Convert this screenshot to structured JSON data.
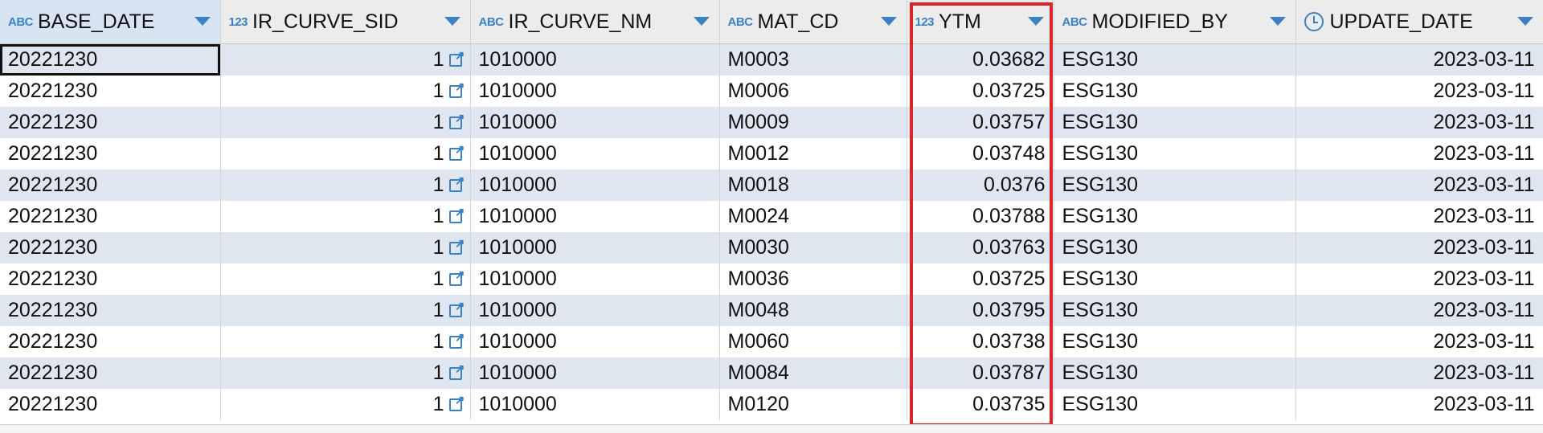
{
  "columns": [
    {
      "type": "ABC",
      "name": "BASE_DATE"
    },
    {
      "type": "123",
      "name": "IR_CURVE_SID"
    },
    {
      "type": "ABC",
      "name": "IR_CURVE_NM"
    },
    {
      "type": "ABC",
      "name": "MAT_CD"
    },
    {
      "type": "123",
      "name": "YTM"
    },
    {
      "type": "ABC",
      "name": "MODIFIED_BY"
    },
    {
      "type": "clock-icon",
      "name": "UPDATE_DATE"
    }
  ],
  "rows": [
    [
      "20221230",
      "1",
      "1010000",
      "M0003",
      "0.03682",
      "ESG130",
      "2023-03-11"
    ],
    [
      "20221230",
      "1",
      "1010000",
      "M0006",
      "0.03725",
      "ESG130",
      "2023-03-11"
    ],
    [
      "20221230",
      "1",
      "1010000",
      "M0009",
      "0.03757",
      "ESG130",
      "2023-03-11"
    ],
    [
      "20221230",
      "1",
      "1010000",
      "M0012",
      "0.03748",
      "ESG130",
      "2023-03-11"
    ],
    [
      "20221230",
      "1",
      "1010000",
      "M0018",
      "0.0376",
      "ESG130",
      "2023-03-11"
    ],
    [
      "20221230",
      "1",
      "1010000",
      "M0024",
      "0.03788",
      "ESG130",
      "2023-03-11"
    ],
    [
      "20221230",
      "1",
      "1010000",
      "M0030",
      "0.03763",
      "ESG130",
      "2023-03-11"
    ],
    [
      "20221230",
      "1",
      "1010000",
      "M0036",
      "0.03725",
      "ESG130",
      "2023-03-11"
    ],
    [
      "20221230",
      "1",
      "1010000",
      "M0048",
      "0.03795",
      "ESG130",
      "2023-03-11"
    ],
    [
      "20221230",
      "1",
      "1010000",
      "M0060",
      "0.03738",
      "ESG130",
      "2023-03-11"
    ],
    [
      "20221230",
      "1",
      "1010000",
      "M0084",
      "0.03787",
      "ESG130",
      "2023-03-11"
    ],
    [
      "20221230",
      "1",
      "1010000",
      "M0120",
      "0.03735",
      "ESG130",
      "2023-03-11"
    ]
  ],
  "colors": {
    "accent": "#3b82c4",
    "highlight": "#d8262c",
    "row_alt": "#dfe6f0",
    "header_bg": "#ececec"
  },
  "icons": {
    "sort": "chevron-down-icon",
    "link": "external-link-icon",
    "clock": "clock-icon"
  }
}
